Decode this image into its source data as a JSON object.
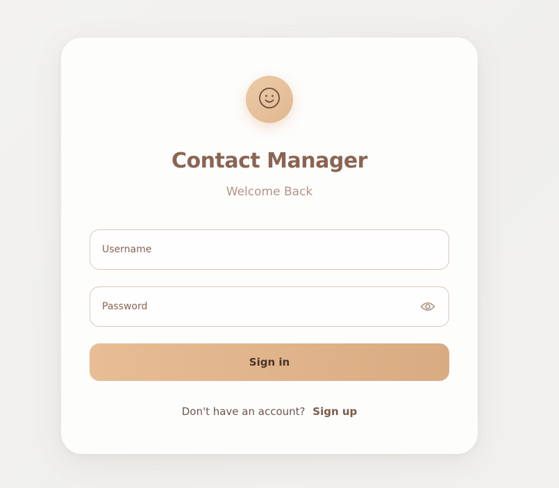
{
  "app": {
    "title": "Contact Manager",
    "subtitle": "Welcome Back"
  },
  "icons": {
    "avatar": "smiley-face-icon",
    "password_toggle": "eye-icon"
  },
  "form": {
    "username_placeholder": "Username",
    "username_value": "",
    "password_placeholder": "Password",
    "password_value": "",
    "signin_label": "Sign in"
  },
  "footer": {
    "prompt": "Don't have an account?",
    "signup_label": "Sign up"
  },
  "colors": {
    "accent": "#e3b68c",
    "title": "#8a6552",
    "subtitle": "#b39484",
    "border": "#dbc6b6",
    "button_text": "#4a3428"
  }
}
